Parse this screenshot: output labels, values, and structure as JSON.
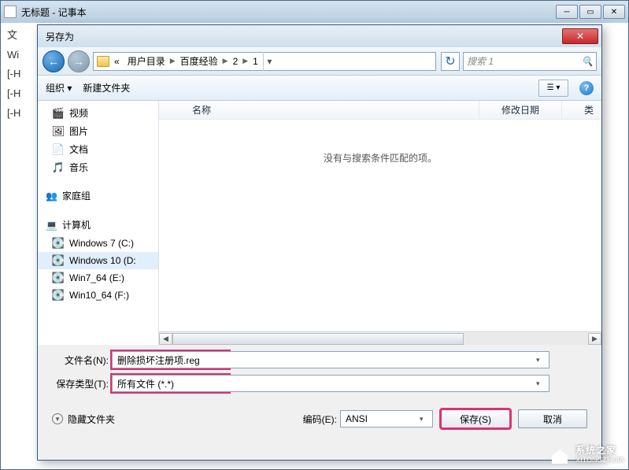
{
  "notepad": {
    "title": "无标题 - 记事本",
    "line1": "文",
    "line2": "Wi",
    "line3": "[-H",
    "line4": "[-H",
    "line5": "[-H"
  },
  "dialog": {
    "title": "另存为"
  },
  "nav": {
    "crumb_prefix": "«",
    "crumb1": "用户目录",
    "crumb2": "百度经验",
    "crumb3": "2",
    "crumb4": "1",
    "search_placeholder": "搜索 1"
  },
  "toolbar": {
    "organize": "组织 ▾",
    "newfolder": "新建文件夹"
  },
  "sidebar": {
    "video": "视频",
    "pictures": "图片",
    "docs": "文档",
    "music": "音乐",
    "homegroup": "家庭组",
    "computer": "计算机",
    "drive_c": "Windows 7 (C:)",
    "drive_d": "Windows 10 (D:",
    "drive_e": "Win7_64 (E:)",
    "drive_f": "Win10_64 (F:)"
  },
  "columns": {
    "name": "名称",
    "modified": "修改日期",
    "type": "类"
  },
  "files": {
    "empty": "没有与搜索条件匹配的项。"
  },
  "form": {
    "filename_label": "文件名(N):",
    "filename_value": "删除损坏注册项.reg",
    "type_label": "保存类型(T):",
    "type_value": "所有文件 (*.*)"
  },
  "footer": {
    "hidefolders": "隐藏文件夹",
    "encoding_label": "编码(E):",
    "encoding_value": "ANSI",
    "save": "保存(S)",
    "cancel": "取消"
  },
  "watermark": {
    "name": "系统之家",
    "url": "XITONGZHIJIA"
  }
}
